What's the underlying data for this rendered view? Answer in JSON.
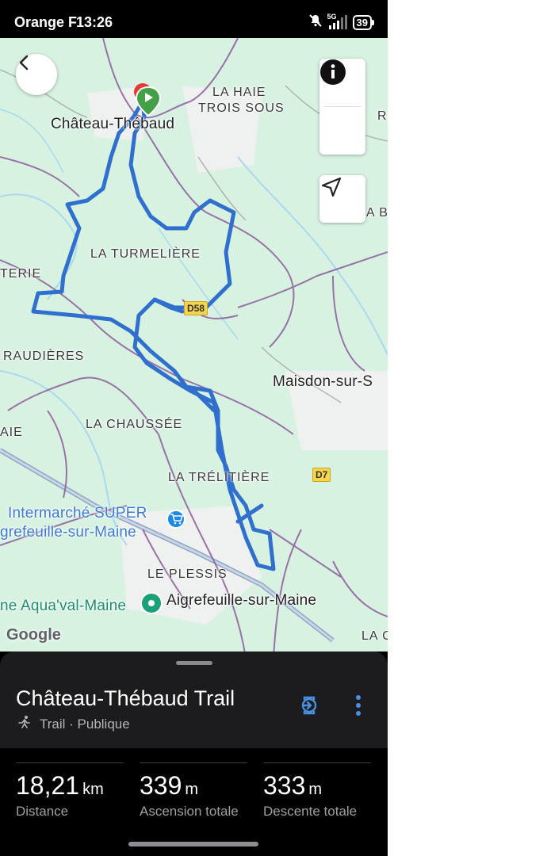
{
  "status_bar": {
    "carrier": "Orange F",
    "time": "13:26",
    "network": "5G",
    "battery": "39"
  },
  "map": {
    "labels": {
      "chateau": "Château-Thébaud",
      "la_haie": "LA HAIE",
      "trois_sous": "TROIS SOUS",
      "edge_r": "R",
      "edge_b": "A B",
      "turmeliere": "LA TURMELIÈRE",
      "terie": "TERIE",
      "raudieres": "RAUDIÈRES",
      "maisdon": "Maisdon-sur-S",
      "aie": "AIE",
      "chaussee": "LA CHAUSSÉE",
      "trelitiere": "LA TRÉLITIÈRE",
      "intermarche": "Intermarché SUPER",
      "aigrefeuille_sub": "grefeuille-sur-Maine",
      "plessis": "LE PLESSIS",
      "aqua": "ne Aqua'val-Maine",
      "aigrefeuille": "Aigrefeuille-sur-Maine",
      "la_edge": "LA C"
    },
    "roads": {
      "d58": "D58",
      "d7": "D7"
    },
    "google": "Google",
    "colors": {
      "trail": "#2f6fce",
      "start_marker": "#43a047",
      "land": "#d8f2e2"
    },
    "icons": {
      "back": "arrow-back-icon",
      "layers": "layers-icon",
      "info": "info-icon",
      "navigate": "navigate-arrow-icon"
    }
  },
  "sheet": {
    "title": "Château-Thébaud Trail",
    "meta": "Trail · Publique",
    "stats": [
      {
        "value": "18,21",
        "unit": "km",
        "label": "Distance"
      },
      {
        "value": "339",
        "unit": "m",
        "label": "Ascension totale"
      },
      {
        "value": "333",
        "unit": "m",
        "label": "Descente totale"
      }
    ]
  }
}
